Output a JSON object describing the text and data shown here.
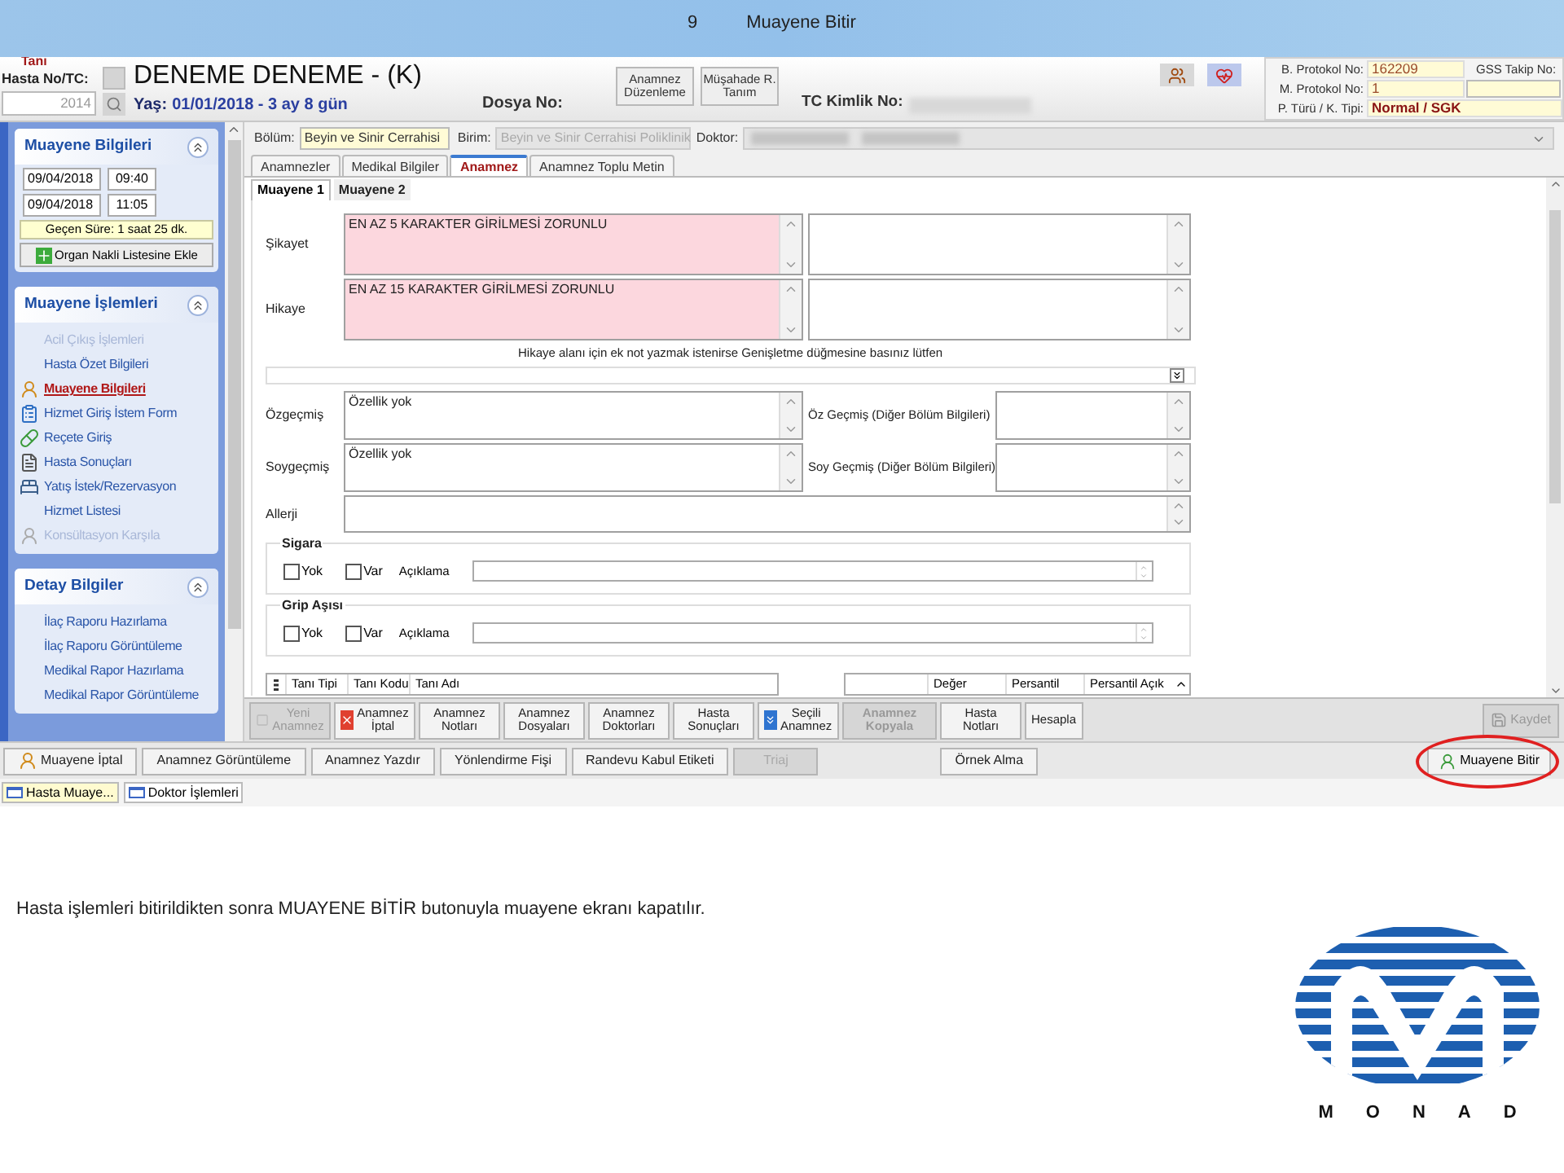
{
  "slide": {
    "number": "9",
    "title": "Muayene Bitir",
    "caption": "Hasta işlemleri bitirildikten sonra MUAYENE BİTİR butonuyla muayene ekranı kapatılır.",
    "logo_letters": [
      "M",
      "O",
      "N",
      "A",
      "D"
    ]
  },
  "patient": {
    "top_label": "Tanı",
    "no_label": "Hasta No/TC:",
    "no_value": "2014",
    "name": "DENEME DENEME - (K)",
    "age_label": "Yaş:",
    "age_value": "01/01/2018 - 3 ay 8 gün",
    "file_label": "Dosya No:",
    "tc_label": "TC Kimlik No:"
  },
  "header_buttons": [
    {
      "label": "Anamnez Düzenleme"
    },
    {
      "label": "Müşahade R. Tanım"
    }
  ],
  "protocol": [
    {
      "label": "B. Protokol No:",
      "value": "162209"
    },
    {
      "label": "M. Protokol No:",
      "value": "1"
    },
    {
      "label": "P. Türü / K. Tipi:",
      "value": "Normal / SGK"
    }
  ],
  "gss_label": "GSS Takip No:",
  "sidebar": {
    "info": {
      "title": "Muayene Bilgileri",
      "expanded": true,
      "times": [
        {
          "date": "09/04/2018",
          "time": "09:40"
        },
        {
          "date": "09/04/2018",
          "time": "11:05"
        }
      ],
      "elapsed": "Geçen Süre: 1 saat 25 dk.",
      "organ_button": "Organ Nakli Listesine Ekle"
    },
    "sections": [
      {
        "title": "Muayene İşlemleri",
        "expanded": true,
        "items": [
          {
            "label": "Acil Çıkış İşlemleri",
            "kind": "plain",
            "disabled": true,
            "selected": false
          },
          {
            "label": "Hasta Özet Bilgileri",
            "kind": "plain",
            "disabled": false,
            "selected": false
          },
          {
            "label": "Muayene Bilgileri",
            "kind": "person",
            "disabled": false,
            "selected": true
          },
          {
            "label": "Hizmet Giriş İstem Form",
            "kind": "form",
            "disabled": false,
            "selected": false
          },
          {
            "label": "Reçete Giriş",
            "kind": "prescription",
            "disabled": false,
            "selected": false
          },
          {
            "label": "Hasta Sonuçları",
            "kind": "results",
            "disabled": false,
            "selected": false
          },
          {
            "label": "Yatış İstek/Rezervasyon",
            "kind": "bed",
            "disabled": false,
            "selected": false
          },
          {
            "label": "Hizmet Listesi",
            "kind": "plain",
            "disabled": false,
            "selected": false
          },
          {
            "label": "Konsültasyon Karşıla",
            "kind": "consult",
            "disabled": true,
            "selected": false
          }
        ]
      },
      {
        "title": "Detay Bilgiler",
        "expanded": true,
        "items": [
          {
            "label": "İlaç Raporu Hazırlama",
            "kind": "plain",
            "disabled": false,
            "selected": false
          },
          {
            "label": "İlaç Raporu Görüntüleme",
            "kind": "plain",
            "disabled": false,
            "selected": false
          },
          {
            "label": "Medikal Rapor Hazırlama",
            "kind": "plain",
            "disabled": false,
            "selected": false
          },
          {
            "label": "Medikal Rapor Görüntüleme",
            "kind": "plain",
            "disabled": false,
            "selected": false
          }
        ]
      }
    ]
  },
  "selectors": {
    "bolum": {
      "label": "Bölüm:",
      "value": "Beyin ve Sinir Cerrahisi"
    },
    "birim": {
      "label": "Birim:",
      "value": "Beyin ve Sinir Cerrahisi  Poliklinik",
      "disabled": true
    },
    "doktor": {
      "label": "Doktor:"
    }
  },
  "tabs": [
    {
      "label": "Anamnezler",
      "selected": false
    },
    {
      "label": "Medikal Bilgiler",
      "selected": false
    },
    {
      "label": "Anamnez",
      "selected": true
    },
    {
      "label": "Anamnez Toplu Metin",
      "selected": false
    }
  ],
  "subtabs": [
    {
      "label": "Muayene 1",
      "selected": true
    },
    {
      "label": "Muayene 2",
      "selected": false
    }
  ],
  "fields": [
    {
      "kind": "pair",
      "label": "Şikayet",
      "value": "EN AZ 5 KARAKTER GİRİLMESİ ZORUNLU",
      "required": true
    },
    {
      "kind": "pair",
      "label": "Hikaye",
      "value": "EN AZ 15 KARAKTER GİRİLMESİ ZORUNLU",
      "required": true
    },
    {
      "kind": "hint",
      "label": "Hikaye alanı için ek not yazmak istenirse Genişletme düğmesine basınız lütfen"
    },
    {
      "kind": "split",
      "label": "Özgeçmiş",
      "value": "Özellik yok",
      "side_label": "Öz Geçmiş (Diğer Bölüm Bilgileri)",
      "required": false
    },
    {
      "kind": "split",
      "label": "Soygeçmiş",
      "value": "Özellik yok",
      "side_label": "Soy Geçmiş (Diğer Bölüm Bilgileri)",
      "required": false
    },
    {
      "kind": "wide",
      "label": "Allerji",
      "required": false
    }
  ],
  "habits": [
    {
      "title": "Sigara",
      "options": [
        {
          "label": "Yok",
          "checked": false
        },
        {
          "label": "Var",
          "checked": false
        }
      ],
      "note_label": "Açıklama"
    },
    {
      "title": "Grip Aşısı",
      "options": [
        {
          "label": "Yok",
          "checked": false
        },
        {
          "label": "Var",
          "checked": false
        }
      ],
      "note_label": "Açıklama"
    }
  ],
  "diagnosis_columns": [
    "Tanı Tipi",
    "Tanı Kodu",
    "Tanı Adı"
  ],
  "percentile_columns": [
    "Değer",
    "Persantil",
    "Persantil Açık"
  ],
  "toolbar": [
    {
      "label": "Yeni Anamnez",
      "kind": "blank",
      "disabled": true
    },
    {
      "label": "Anamnez İptal",
      "kind": "cancel",
      "disabled": false
    },
    {
      "label": "Anamnez Notları",
      "kind": "plain",
      "disabled": false
    },
    {
      "label": "Anamnez Dosyaları",
      "kind": "plain",
      "disabled": false
    },
    {
      "label": "Anamnez Doktorları",
      "kind": "plain",
      "disabled": false
    },
    {
      "label": "Hasta Sonuçları",
      "kind": "plain",
      "disabled": false
    },
    {
      "label": "Seçili Anamnez",
      "kind": "chevrons",
      "disabled": false
    },
    {
      "label": "Anamnez Kopyala",
      "kind": "plain",
      "disabled": true
    },
    {
      "label": "Hasta Notları",
      "kind": "plain",
      "disabled": false
    },
    {
      "label": "Hesapla",
      "kind": "plain",
      "disabled": false
    }
  ],
  "save_button": {
    "label": "Kaydet",
    "disabled": true
  },
  "action_bar": [
    {
      "label": "Muayene İptal",
      "kind": "person",
      "disabled": false
    },
    {
      "label": "Anamnez Görüntüleme",
      "kind": "plain",
      "disabled": false
    },
    {
      "label": "Anamnez Yazdır",
      "kind": "plain",
      "disabled": false
    },
    {
      "label": "Yönlendirme Fişi",
      "kind": "plain",
      "disabled": false
    },
    {
      "label": "Randevu Kabul Etiketi",
      "kind": "plain",
      "disabled": false
    },
    {
      "label": "Triaj",
      "kind": "plain",
      "disabled": true
    },
    {
      "label": "Örnek Alma",
      "kind": "plain",
      "disabled": false
    }
  ],
  "finish_button": {
    "label": "Muayene Bitir",
    "highlighted": true
  },
  "taskbar": [
    {
      "label": "Hasta Muaye...",
      "selected": true
    },
    {
      "label": "Doktor İşlemleri",
      "selected": false
    }
  ]
}
